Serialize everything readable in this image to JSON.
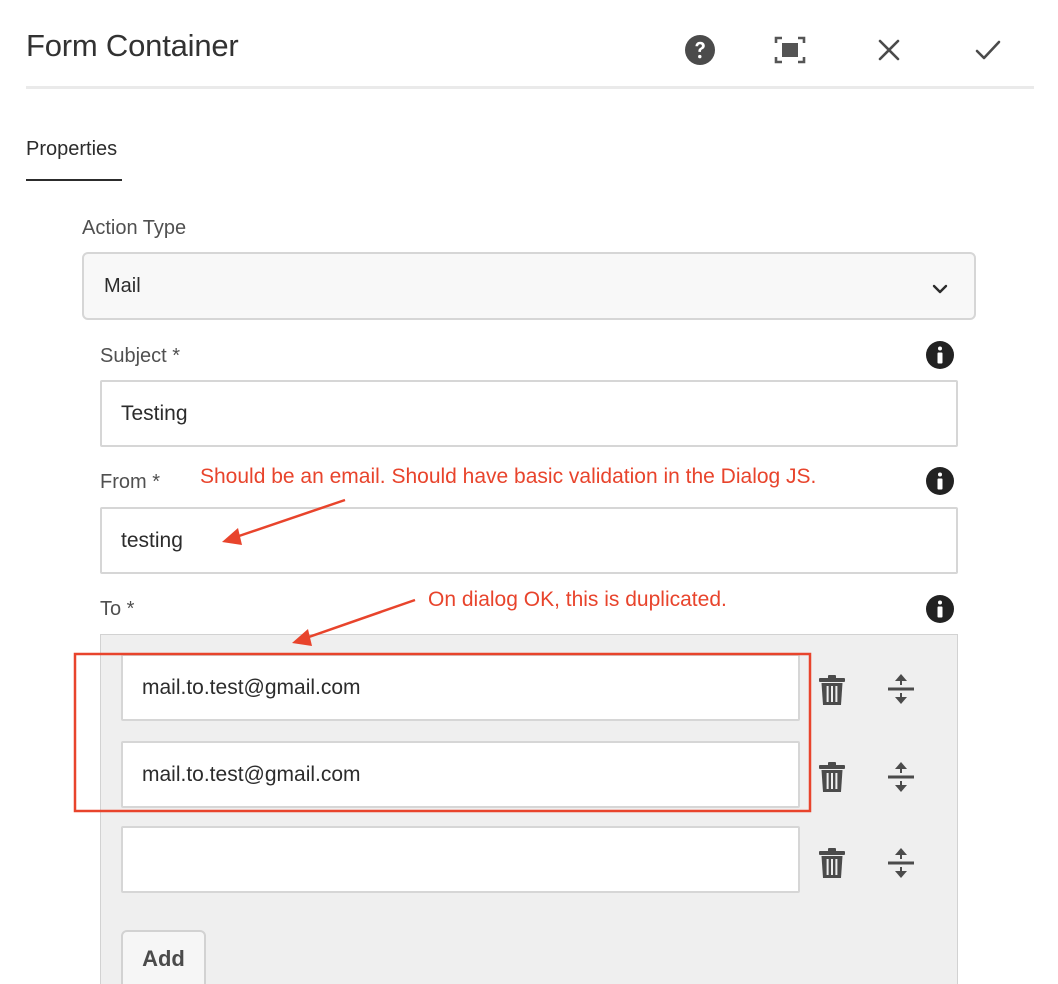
{
  "dialog": {
    "title": "Form Container",
    "header_icons": [
      "help-icon",
      "fullscreen-icon",
      "close-icon",
      "check-icon"
    ]
  },
  "tabs": [
    {
      "label": "Properties",
      "active": true
    }
  ],
  "action_type": {
    "label": "Action Type",
    "value": "Mail"
  },
  "subject": {
    "label": "Subject *",
    "value": "Testing"
  },
  "from": {
    "label": "From *",
    "value": "testing"
  },
  "to": {
    "label": "To *",
    "items": [
      {
        "value": "mail.to.test@gmail.com"
      },
      {
        "value": "mail.to.test@gmail.com"
      },
      {
        "value": ""
      }
    ],
    "add_label": "Add"
  },
  "annotations": {
    "from_note": "Should be an email. Should have basic validation in the Dialog JS.",
    "to_note": "On dialog OK, this is duplicated."
  },
  "colors": {
    "annotation": "#e8442c",
    "icon": "#3a3a3a",
    "panel": "#efefef"
  }
}
